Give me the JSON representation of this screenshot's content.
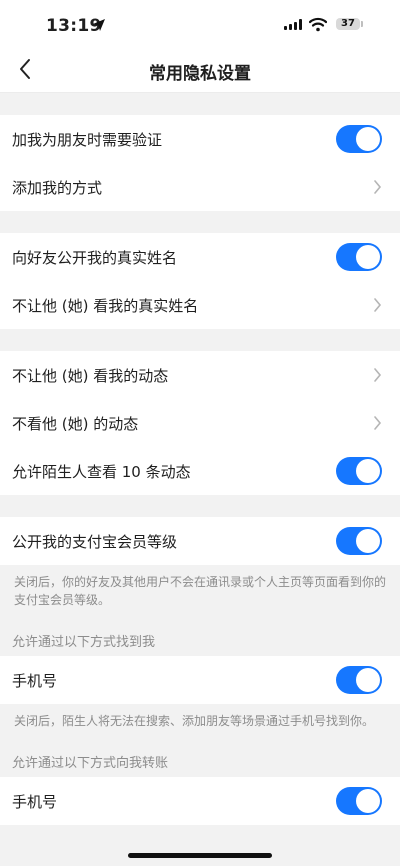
{
  "status_bar": {
    "time": "13:19",
    "battery": "37"
  },
  "nav": {
    "title": "常用隐私设置"
  },
  "groups": [
    {
      "rows": [
        {
          "label": "加我为朋友时需要验证",
          "control": "toggle",
          "on": true
        },
        {
          "label": "添加我的方式",
          "control": "chevron"
        }
      ]
    },
    {
      "rows": [
        {
          "label": "向好友公开我的真实姓名",
          "control": "toggle",
          "on": true
        },
        {
          "label": "不让他 (她) 看我的真实姓名",
          "control": "chevron"
        }
      ]
    },
    {
      "rows": [
        {
          "label": "不让他 (她) 看我的动态",
          "control": "chevron"
        },
        {
          "label": "不看他 (她) 的动态",
          "control": "chevron"
        },
        {
          "label": "允许陌生人查看 10 条动态",
          "control": "toggle",
          "on": true
        }
      ]
    },
    {
      "rows": [
        {
          "label": "公开我的支付宝会员等级",
          "control": "toggle",
          "on": true
        }
      ]
    }
  ],
  "notes": {
    "member_level": "关闭后，你的好友及其他用户不会在通讯录或个人主页等页面看到你的支付宝会员等级。",
    "phone_find": "关闭后，陌生人将无法在搜索、添加朋友等场景通过手机号找到你。"
  },
  "sections": {
    "find_me": {
      "header": "允许通过以下方式找到我",
      "row_label": "手机号"
    },
    "transfer": {
      "header": "允许通过以下方式向我转账",
      "row_label": "手机号"
    }
  },
  "colors": {
    "accent": "#1677ff",
    "background": "#f2f2f2"
  }
}
